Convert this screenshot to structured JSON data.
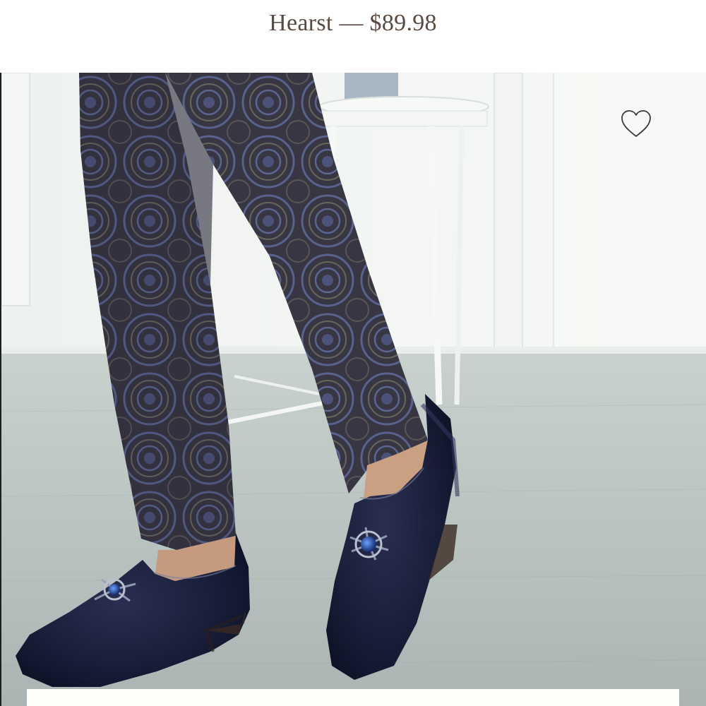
{
  "product": {
    "title": "Hearst — $89.98"
  },
  "icons": {
    "favorite": "heart-outline-icon"
  },
  "colors": {
    "title_text": "#5a4a42",
    "background": "#ffffff",
    "heart_stroke": "#3a3a3a"
  }
}
